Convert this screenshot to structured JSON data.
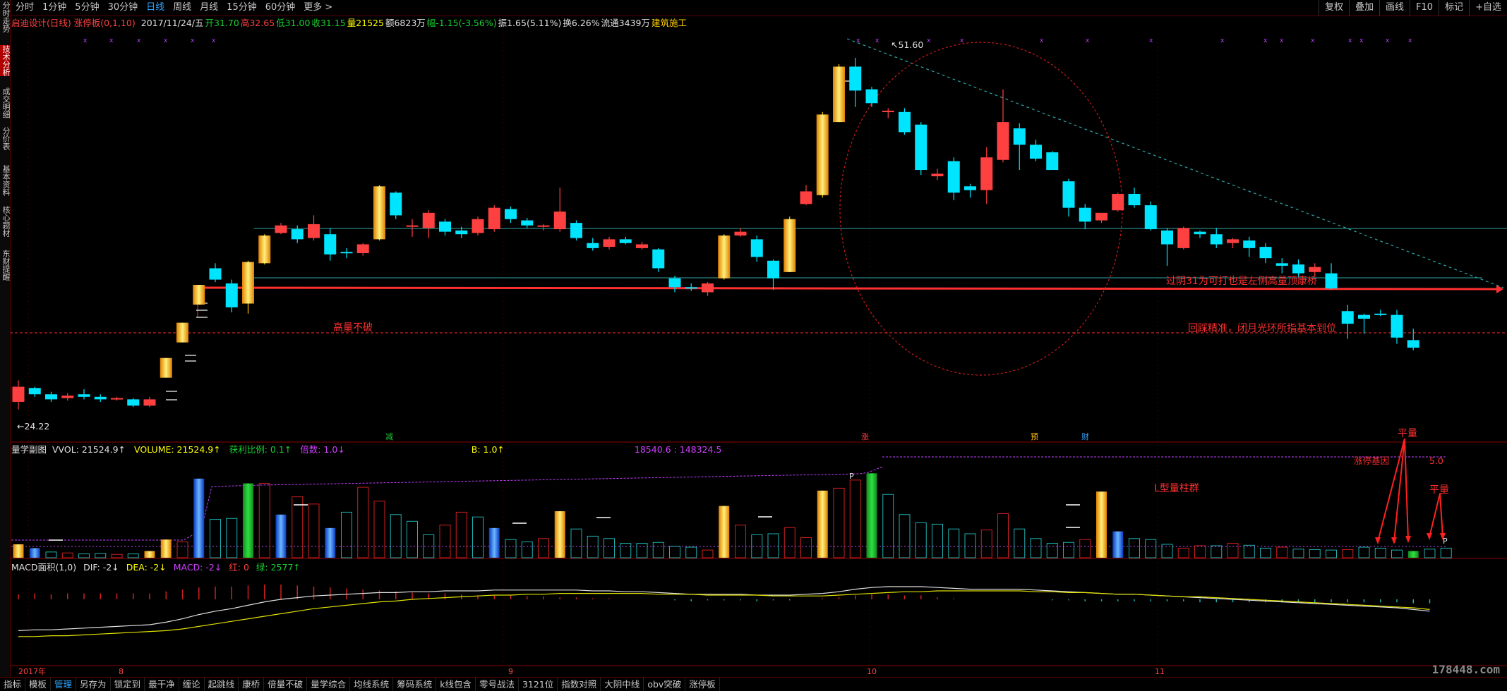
{
  "topbar": {
    "tabs": [
      "分时",
      "1分钟",
      "5分钟",
      "30分钟",
      "日线",
      "周线",
      "月线",
      "15分钟",
      "60分钟",
      "更多 >"
    ],
    "active_tab": "日线",
    "right_tools": [
      "复权",
      "叠加",
      "画线",
      "F10",
      "标记",
      "+自选"
    ]
  },
  "sidebar": {
    "tabs": [
      "分时走势",
      "技术分析",
      "成交明细",
      "分价表",
      "基本资料",
      "核心题材",
      "东财提醒"
    ],
    "active": "技术分析"
  },
  "info": {
    "name": "启迪设计(日线) 涨停板(0,1,10)",
    "date": "2017/11/24/五",
    "open": "开31.70",
    "high": "高32.65",
    "low": "低31.00",
    "close": "收31.15",
    "volume": "量21525",
    "amount": "额6823万",
    "change": "幅-1.15(-3.56%)",
    "amplitude": "振1.65(5.11%)",
    "turnover": "换6.26%",
    "float": "流通3439万",
    "sector": "建筑施工"
  },
  "annotations": {
    "high_price": "51.60",
    "low_price": "24.22",
    "gaoliang": "高量不破",
    "right_line": "过阴31为可打也是左侧高量顶康桥",
    "right_bottom": "回踩精准，闭月光环所指基本到位",
    "l_group": "L型量柱群",
    "pingliang1": "平量",
    "pingliang2": "平量",
    "zhangting": "涨停基因",
    "p_marker": "P",
    "value_5": "5.0"
  },
  "event_marks": [
    "减",
    "涨",
    "预",
    "财"
  ],
  "volume_panel": {
    "label": "量学副图",
    "vvol": "VVOL: 21524.9↑",
    "volume": "VOLUME: 21524.9↑",
    "ratio": "获利比例: 0.1↑",
    "multiple": "倍数: 1.0↓",
    "b": "B: 1.0↑",
    "range": "18540.6 : 148324.5"
  },
  "macd_panel": {
    "label": "MACD面积(1,0)",
    "dif": "DIF: -2↓",
    "dea": "DEA: -2↓",
    "macd": "MACD: -2↓",
    "red": "红: 0",
    "green": "绿: 2577↑"
  },
  "x_axis": {
    "labels": [
      "2017年",
      "8",
      "9",
      "10",
      "11"
    ]
  },
  "bottombar": {
    "tabs": [
      "指标",
      "模板",
      "管理",
      "另存为",
      "锁定到",
      "最干净",
      "缠论",
      "起跳线",
      "康桥",
      "倍量不破",
      "量学综合",
      "均线系统",
      "筹码系统",
      "k线包含",
      "零号战法",
      "3121位",
      "指数对照",
      "大阴中线",
      "obv突破",
      "涨停板"
    ],
    "active": "管理"
  },
  "watermark": "178448.com",
  "colors": {
    "up": "#ff4040",
    "down": "#00e5ff",
    "gold": "#ffc000",
    "blue": "#1e6fff",
    "green": "#18b030",
    "grid": "#8b0000"
  },
  "chart_data": {
    "type": "candlestick",
    "title": "启迪设计(日线)",
    "ylim": [
      22,
      54
    ],
    "candles": [
      {
        "o": 24.8,
        "h": 26.5,
        "l": 24.2,
        "c": 26.0,
        "k": "up"
      },
      {
        "o": 25.9,
        "h": 26.0,
        "l": 25.2,
        "c": 25.4,
        "k": "down"
      },
      {
        "o": 25.4,
        "h": 25.6,
        "l": 24.8,
        "c": 25.0,
        "k": "down"
      },
      {
        "o": 25.1,
        "h": 25.5,
        "l": 24.9,
        "c": 25.3,
        "k": "up"
      },
      {
        "o": 25.4,
        "h": 25.8,
        "l": 25.0,
        "c": 25.2,
        "k": "down"
      },
      {
        "o": 25.2,
        "h": 25.4,
        "l": 24.8,
        "c": 25.0,
        "k": "down"
      },
      {
        "o": 25.0,
        "h": 25.2,
        "l": 24.9,
        "c": 25.1,
        "k": "up"
      },
      {
        "o": 25.0,
        "h": 25.1,
        "l": 24.4,
        "c": 24.5,
        "k": "down"
      },
      {
        "o": 24.5,
        "h": 25.2,
        "l": 24.4,
        "c": 25.0,
        "k": "up"
      },
      {
        "o": 27.5,
        "h": 27.5,
        "l": 27.5,
        "c": 27.5,
        "k": "limit"
      },
      {
        "o": 30.3,
        "h": 30.3,
        "l": 30.3,
        "c": 30.3,
        "k": "limit"
      },
      {
        "o": 33.3,
        "h": 33.3,
        "l": 33.3,
        "c": 33.3,
        "k": "limit"
      },
      {
        "o": 35.4,
        "h": 35.8,
        "l": 34.3,
        "c": 34.5,
        "k": "down"
      },
      {
        "o": 34.2,
        "h": 34.5,
        "l": 31.9,
        "c": 32.3,
        "k": "down"
      },
      {
        "o": 32.6,
        "h": 36.0,
        "l": 31.8,
        "c": 35.9,
        "k": "limit"
      },
      {
        "o": 35.8,
        "h": 38.1,
        "l": 35.7,
        "c": 38.0,
        "k": "limit"
      },
      {
        "o": 38.2,
        "h": 39.0,
        "l": 38.1,
        "c": 38.8,
        "k": "up"
      },
      {
        "o": 38.5,
        "h": 38.8,
        "l": 37.4,
        "c": 37.7,
        "k": "down"
      },
      {
        "o": 37.8,
        "h": 39.6,
        "l": 37.6,
        "c": 38.9,
        "k": "up"
      },
      {
        "o": 38.1,
        "h": 38.6,
        "l": 36.0,
        "c": 36.5,
        "k": "down"
      },
      {
        "o": 36.6,
        "h": 37.0,
        "l": 36.2,
        "c": 36.7,
        "k": "down"
      },
      {
        "o": 36.6,
        "h": 37.4,
        "l": 36.4,
        "c": 37.3,
        "k": "up"
      },
      {
        "o": 37.7,
        "h": 42.0,
        "l": 37.6,
        "c": 41.9,
        "k": "limit"
      },
      {
        "o": 41.4,
        "h": 41.5,
        "l": 39.3,
        "c": 39.6,
        "k": "down"
      },
      {
        "o": 38.7,
        "h": 39.3,
        "l": 37.9,
        "c": 38.8,
        "k": "up"
      },
      {
        "o": 38.6,
        "h": 40.0,
        "l": 37.8,
        "c": 39.8,
        "k": "up"
      },
      {
        "o": 39.1,
        "h": 39.3,
        "l": 38.0,
        "c": 38.3,
        "k": "down"
      },
      {
        "o": 38.4,
        "h": 38.7,
        "l": 37.8,
        "c": 38.1,
        "k": "down"
      },
      {
        "o": 38.2,
        "h": 39.5,
        "l": 38.0,
        "c": 39.3,
        "k": "up"
      },
      {
        "o": 38.5,
        "h": 40.4,
        "l": 38.3,
        "c": 40.2,
        "k": "up"
      },
      {
        "o": 40.1,
        "h": 40.3,
        "l": 39.0,
        "c": 39.3,
        "k": "down"
      },
      {
        "o": 39.2,
        "h": 39.4,
        "l": 38.6,
        "c": 38.8,
        "k": "down"
      },
      {
        "o": 38.7,
        "h": 38.9,
        "l": 38.4,
        "c": 38.8,
        "k": "up"
      },
      {
        "o": 38.5,
        "h": 41.8,
        "l": 38.3,
        "c": 39.9,
        "k": "up"
      },
      {
        "o": 39.0,
        "h": 39.2,
        "l": 37.6,
        "c": 37.8,
        "k": "down"
      },
      {
        "o": 37.4,
        "h": 37.8,
        "l": 36.8,
        "c": 37.0,
        "k": "down"
      },
      {
        "o": 37.1,
        "h": 37.9,
        "l": 36.9,
        "c": 37.7,
        "k": "up"
      },
      {
        "o": 37.7,
        "h": 37.9,
        "l": 37.3,
        "c": 37.4,
        "k": "down"
      },
      {
        "o": 37.3,
        "h": 37.5,
        "l": 36.9,
        "c": 37.0,
        "k": "up"
      },
      {
        "o": 36.9,
        "h": 37.0,
        "l": 35.1,
        "c": 35.4,
        "k": "down"
      },
      {
        "o": 34.6,
        "h": 34.8,
        "l": 33.5,
        "c": 33.9,
        "k": "down"
      },
      {
        "o": 33.9,
        "h": 34.2,
        "l": 33.6,
        "c": 33.9,
        "k": "down"
      },
      {
        "o": 33.5,
        "h": 34.3,
        "l": 33.2,
        "c": 34.2,
        "k": "up"
      },
      {
        "o": 34.6,
        "h": 38.1,
        "l": 34.5,
        "c": 38.0,
        "k": "limit"
      },
      {
        "o": 38.3,
        "h": 38.6,
        "l": 37.9,
        "c": 38.0,
        "k": "up"
      },
      {
        "o": 37.7,
        "h": 38.0,
        "l": 35.9,
        "c": 36.3,
        "k": "down"
      },
      {
        "o": 36.0,
        "h": 36.1,
        "l": 33.7,
        "c": 34.6,
        "k": "down"
      },
      {
        "o": 35.1,
        "h": 39.5,
        "l": 35.1,
        "c": 39.3,
        "k": "limit"
      },
      {
        "o": 40.5,
        "h": 42.0,
        "l": 40.4,
        "c": 41.5,
        "k": "up"
      },
      {
        "o": 41.2,
        "h": 47.8,
        "l": 41.0,
        "c": 47.6,
        "k": "limit"
      },
      {
        "o": 47.0,
        "h": 51.6,
        "l": 47.0,
        "c": 51.4,
        "k": "limit"
      },
      {
        "o": 51.4,
        "h": 52.1,
        "l": 48.2,
        "c": 49.5,
        "k": "down"
      },
      {
        "o": 49.6,
        "h": 49.8,
        "l": 48.2,
        "c": 48.5,
        "k": "down"
      },
      {
        "o": 47.8,
        "h": 48.1,
        "l": 47.3,
        "c": 47.9,
        "k": "up"
      },
      {
        "o": 47.8,
        "h": 48.1,
        "l": 46.0,
        "c": 46.2,
        "k": "down"
      },
      {
        "o": 46.8,
        "h": 47.0,
        "l": 42.8,
        "c": 43.2,
        "k": "down"
      },
      {
        "o": 42.7,
        "h": 43.3,
        "l": 42.4,
        "c": 42.9,
        "k": "up"
      },
      {
        "o": 43.9,
        "h": 44.2,
        "l": 40.8,
        "c": 41.4,
        "k": "down"
      },
      {
        "o": 41.9,
        "h": 42.1,
        "l": 41.0,
        "c": 41.6,
        "k": "down"
      },
      {
        "o": 41.6,
        "h": 45.0,
        "l": 40.5,
        "c": 44.2,
        "k": "up"
      },
      {
        "o": 44.0,
        "h": 49.6,
        "l": 43.8,
        "c": 47.0,
        "k": "up"
      },
      {
        "o": 46.5,
        "h": 46.9,
        "l": 43.2,
        "c": 45.2,
        "k": "down"
      },
      {
        "o": 45.2,
        "h": 45.6,
        "l": 43.9,
        "c": 44.1,
        "k": "down"
      },
      {
        "o": 44.6,
        "h": 44.7,
        "l": 43.2,
        "c": 43.2,
        "k": "down"
      },
      {
        "o": 42.3,
        "h": 42.5,
        "l": 39.5,
        "c": 40.2,
        "k": "down"
      },
      {
        "o": 40.2,
        "h": 40.5,
        "l": 38.5,
        "c": 39.1,
        "k": "down"
      },
      {
        "o": 39.2,
        "h": 39.8,
        "l": 39.0,
        "c": 39.8,
        "k": "up"
      },
      {
        "o": 40.0,
        "h": 41.4,
        "l": 39.9,
        "c": 41.3,
        "k": "up"
      },
      {
        "o": 41.3,
        "h": 41.8,
        "l": 40.2,
        "c": 40.4,
        "k": "down"
      },
      {
        "o": 40.4,
        "h": 40.7,
        "l": 38.4,
        "c": 38.5,
        "k": "down"
      },
      {
        "o": 38.4,
        "h": 38.6,
        "l": 35.6,
        "c": 37.3,
        "k": "down"
      },
      {
        "o": 37.0,
        "h": 38.7,
        "l": 36.9,
        "c": 38.6,
        "k": "up"
      },
      {
        "o": 38.1,
        "h": 38.4,
        "l": 37.8,
        "c": 38.3,
        "k": "down"
      },
      {
        "o": 38.1,
        "h": 38.6,
        "l": 37.0,
        "c": 37.3,
        "k": "down"
      },
      {
        "o": 37.7,
        "h": 37.8,
        "l": 37.0,
        "c": 37.4,
        "k": "up"
      },
      {
        "o": 37.6,
        "h": 37.9,
        "l": 36.3,
        "c": 37.0,
        "k": "down"
      },
      {
        "o": 37.1,
        "h": 37.4,
        "l": 35.8,
        "c": 36.2,
        "k": "down"
      },
      {
        "o": 35.8,
        "h": 36.2,
        "l": 35.0,
        "c": 35.6,
        "k": "down"
      },
      {
        "o": 35.7,
        "h": 36.1,
        "l": 34.7,
        "c": 35.0,
        "k": "down"
      },
      {
        "o": 35.1,
        "h": 35.8,
        "l": 34.8,
        "c": 35.5,
        "k": "up"
      },
      {
        "o": 35.0,
        "h": 35.8,
        "l": 33.7,
        "c": 33.8,
        "k": "down"
      },
      {
        "o": 32.0,
        "h": 32.5,
        "l": 29.8,
        "c": 31.0,
        "k": "down"
      },
      {
        "o": 31.7,
        "h": 31.8,
        "l": 30.2,
        "c": 31.4,
        "k": "down"
      },
      {
        "o": 31.8,
        "h": 32.1,
        "l": 31.6,
        "c": 31.7,
        "k": "down"
      },
      {
        "o": 31.7,
        "h": 32.1,
        "l": 29.4,
        "c": 29.9,
        "k": "down"
      },
      {
        "o": 29.7,
        "h": 30.6,
        "l": 28.9,
        "c": 29.1,
        "k": "down"
      }
    ],
    "volumes": [
      {
        "v": 28,
        "c": "gold"
      },
      {
        "v": 20,
        "c": "blue"
      },
      {
        "v": 12,
        "c": "cy"
      },
      {
        "v": 10,
        "c": "rd"
      },
      {
        "v": 8,
        "c": "cy"
      },
      {
        "v": 9,
        "c": "cy"
      },
      {
        "v": 7,
        "c": "rd"
      },
      {
        "v": 8,
        "c": "cy"
      },
      {
        "v": 14,
        "c": "gold"
      },
      {
        "v": 38,
        "c": "gold"
      },
      {
        "v": 33,
        "c": "rd"
      },
      {
        "v": 165,
        "c": "blue"
      },
      {
        "v": 80,
        "c": "cy"
      },
      {
        "v": 82,
        "c": "cy"
      },
      {
        "v": 155,
        "c": "green"
      },
      {
        "v": 155,
        "c": "rd"
      },
      {
        "v": 90,
        "c": "blue"
      },
      {
        "v": 127,
        "c": "rd"
      },
      {
        "v": 112,
        "c": "rd"
      },
      {
        "v": 62,
        "c": "blue"
      },
      {
        "v": 95,
        "c": "cy"
      },
      {
        "v": 147,
        "c": "rd"
      },
      {
        "v": 118,
        "c": "rd"
      },
      {
        "v": 90,
        "c": "cy"
      },
      {
        "v": 76,
        "c": "cy"
      },
      {
        "v": 48,
        "c": "cy"
      },
      {
        "v": 68,
        "c": "rd"
      },
      {
        "v": 95,
        "c": "rd"
      },
      {
        "v": 85,
        "c": "cy"
      },
      {
        "v": 62,
        "c": "blue"
      },
      {
        "v": 38,
        "c": "cy"
      },
      {
        "v": 33,
        "c": "cy"
      },
      {
        "v": 40,
        "c": "rd"
      },
      {
        "v": 97,
        "c": "gold"
      },
      {
        "v": 60,
        "c": "cy"
      },
      {
        "v": 45,
        "c": "cy"
      },
      {
        "v": 40,
        "c": "cy"
      },
      {
        "v": 30,
        "c": "cy"
      },
      {
        "v": 30,
        "c": "cy"
      },
      {
        "v": 32,
        "c": "cy"
      },
      {
        "v": 24,
        "c": "cy"
      },
      {
        "v": 22,
        "c": "cy"
      },
      {
        "v": 16,
        "c": "rd"
      },
      {
        "v": 108,
        "c": "gold"
      },
      {
        "v": 68,
        "c": "rd"
      },
      {
        "v": 48,
        "c": "cy"
      },
      {
        "v": 50,
        "c": "cy"
      },
      {
        "v": 63,
        "c": "rd"
      },
      {
        "v": 42,
        "c": "rd"
      },
      {
        "v": 140,
        "c": "gold"
      },
      {
        "v": 145,
        "c": "rd"
      },
      {
        "v": 162,
        "c": "rd"
      },
      {
        "v": 176,
        "c": "green"
      },
      {
        "v": 132,
        "c": "cy"
      },
      {
        "v": 90,
        "c": "cy"
      },
      {
        "v": 73,
        "c": "cy"
      },
      {
        "v": 70,
        "c": "cy"
      },
      {
        "v": 60,
        "c": "cy"
      },
      {
        "v": 50,
        "c": "cy"
      },
      {
        "v": 58,
        "c": "rd"
      },
      {
        "v": 92,
        "c": "rd"
      },
      {
        "v": 60,
        "c": "cy"
      },
      {
        "v": 40,
        "c": "cy"
      },
      {
        "v": 30,
        "c": "cy"
      },
      {
        "v": 32,
        "c": "cy"
      },
      {
        "v": 38,
        "c": "rd"
      },
      {
        "v": 138,
        "c": "gold"
      },
      {
        "v": 55,
        "c": "blue"
      },
      {
        "v": 40,
        "c": "cy"
      },
      {
        "v": 38,
        "c": "cy"
      },
      {
        "v": 28,
        "c": "cy"
      },
      {
        "v": 20,
        "c": "rd"
      },
      {
        "v": 25,
        "c": "rd"
      },
      {
        "v": 25,
        "c": "cy"
      },
      {
        "v": 30,
        "c": "rd"
      },
      {
        "v": 26,
        "c": "cy"
      },
      {
        "v": 20,
        "c": "cy"
      },
      {
        "v": 22,
        "c": "rd"
      },
      {
        "v": 18,
        "c": "cy"
      },
      {
        "v": 17,
        "c": "cy"
      },
      {
        "v": 16,
        "c": "cy"
      },
      {
        "v": 17,
        "c": "rd"
      },
      {
        "v": 22,
        "c": "cy"
      },
      {
        "v": 20,
        "c": "cy"
      },
      {
        "v": 16,
        "c": "cy"
      },
      {
        "v": 14,
        "c": "green"
      },
      {
        "v": 18,
        "c": "cy"
      },
      {
        "v": 20,
        "c": "cy"
      }
    ],
    "macd_dif": [
      -1.5,
      -1.4,
      -1.4,
      -1.3,
      -1.2,
      -1.1,
      -1.0,
      -0.9,
      -0.8,
      -0.5,
      -0.1,
      0.4,
      0.8,
      1.1,
      1.5,
      1.9,
      2.2,
      2.4,
      2.6,
      2.7,
      2.8,
      2.9,
      3.0,
      3.0,
      3.1,
      3.1,
      3.2,
      3.2,
      3.2,
      3.3,
      3.3,
      3.3,
      3.3,
      3.3,
      3.3,
      3.2,
      3.2,
      3.1,
      3.1,
      3.0,
      2.9,
      2.8,
      2.8,
      2.8,
      2.8,
      2.7,
      2.7,
      2.7,
      2.8,
      2.9,
      3.1,
      3.4,
      3.6,
      3.7,
      3.7,
      3.7,
      3.6,
      3.5,
      3.4,
      3.4,
      3.4,
      3.4,
      3.3,
      3.2,
      3.1,
      3.0,
      2.9,
      2.8,
      2.8,
      2.7,
      2.6,
      2.5,
      2.4,
      2.3,
      2.2,
      2.1,
      2.0,
      1.9,
      1.8,
      1.7,
      1.6,
      1.5,
      1.4,
      1.3,
      1.2,
      1.0,
      0.8
    ],
    "macd_dea": [
      -2.0,
      -2.0,
      -1.9,
      -1.9,
      -1.8,
      -1.7,
      -1.6,
      -1.5,
      -1.4,
      -1.3,
      -1.1,
      -0.8,
      -0.5,
      -0.2,
      0.1,
      0.4,
      0.7,
      1.0,
      1.3,
      1.5,
      1.7,
      1.9,
      2.1,
      2.2,
      2.4,
      2.5,
      2.6,
      2.7,
      2.8,
      2.9,
      2.9,
      3.0,
      3.0,
      3.1,
      3.1,
      3.1,
      3.1,
      3.1,
      3.1,
      3.0,
      3.0,
      3.0,
      2.9,
      2.9,
      2.9,
      2.9,
      2.8,
      2.8,
      2.8,
      2.8,
      2.9,
      3.0,
      3.1,
      3.2,
      3.3,
      3.3,
      3.4,
      3.4,
      3.4,
      3.4,
      3.4,
      3.4,
      3.3,
      3.3,
      3.2,
      3.2,
      3.1,
      3.0,
      3.0,
      2.9,
      2.8,
      2.7,
      2.7,
      2.6,
      2.5,
      2.4,
      2.3,
      2.2,
      2.1,
      2.0,
      1.9,
      1.8,
      1.7,
      1.6,
      1.5,
      1.4,
      1.2
    ]
  }
}
